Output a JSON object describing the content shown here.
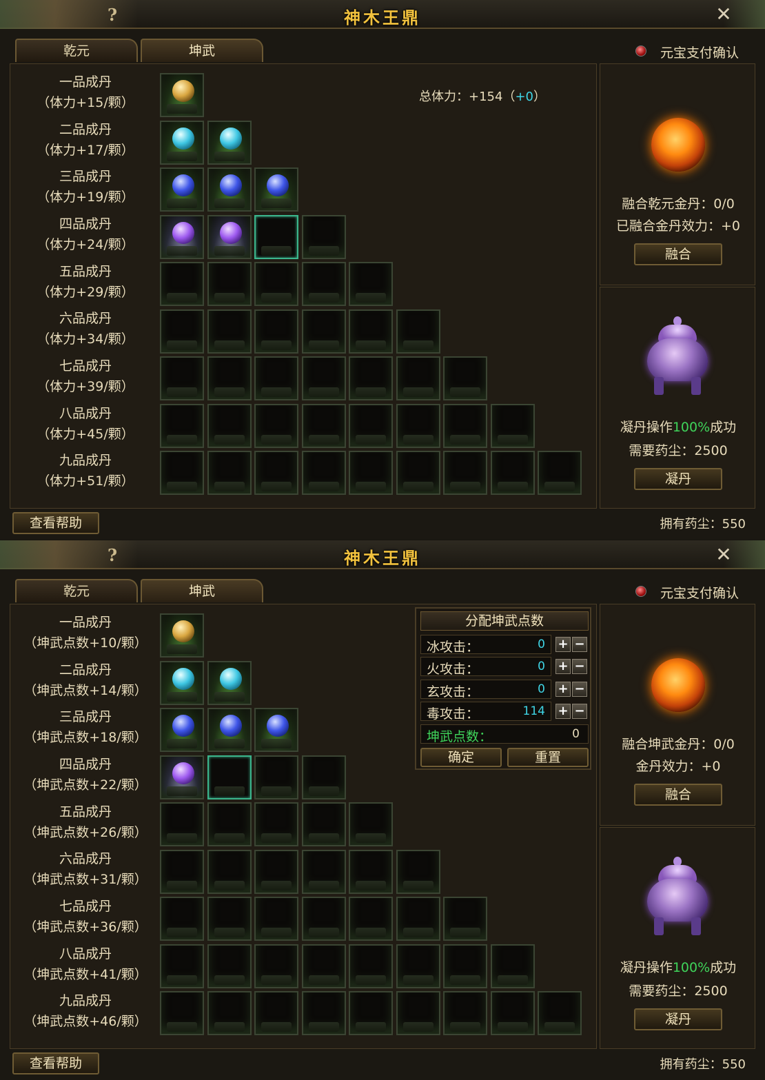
{
  "window_title": "神木王鼎",
  "tabs": [
    "乾元",
    "坤武"
  ],
  "pay_confirm_label": "元宝支付确认",
  "help_button": "查看帮助",
  "owned_dust": "拥有药尘：550",
  "panel1": {
    "rows": [
      {
        "name": "一品成丹",
        "bonus": "（体力+15/颗）"
      },
      {
        "name": "二品成丹",
        "bonus": "（体力+17/颗）"
      },
      {
        "name": "三品成丹",
        "bonus": "（体力+19/颗）"
      },
      {
        "name": "四品成丹",
        "bonus": "（体力+24/颗）"
      },
      {
        "name": "五品成丹",
        "bonus": "（体力+29/颗）"
      },
      {
        "name": "六品成丹",
        "bonus": "（体力+34/颗）"
      },
      {
        "name": "七品成丹",
        "bonus": "（体力+39/颗）"
      },
      {
        "name": "八品成丹",
        "bonus": "（体力+45/颗）"
      },
      {
        "name": "九品成丹",
        "bonus": "（体力+51/颗）"
      }
    ],
    "total_label": "总体力：+154",
    "total_extra": "+0",
    "fuse_label": "融合乾元金丹：0/0",
    "fuse_effect": "已融合金丹效力：+0",
    "fuse_button": "融合",
    "condense_success_prefix": "凝丹操作",
    "condense_success_rate": "100%",
    "condense_success_suffix": "成功",
    "condense_cost": "需要药尘：2500",
    "condense_button": "凝丹"
  },
  "panel2": {
    "rows": [
      {
        "name": "一品成丹",
        "bonus": "（坤武点数+10/颗）"
      },
      {
        "name": "二品成丹",
        "bonus": "（坤武点数+14/颗）"
      },
      {
        "name": "三品成丹",
        "bonus": "（坤武点数+18/颗）"
      },
      {
        "name": "四品成丹",
        "bonus": "（坤武点数+22/颗）"
      },
      {
        "name": "五品成丹",
        "bonus": "（坤武点数+26/颗）"
      },
      {
        "name": "六品成丹",
        "bonus": "（坤武点数+31/颗）"
      },
      {
        "name": "七品成丹",
        "bonus": "（坤武点数+36/颗）"
      },
      {
        "name": "八品成丹",
        "bonus": "（坤武点数+41/颗）"
      },
      {
        "name": "九品成丹",
        "bonus": "（坤武点数+46/颗）"
      }
    ],
    "distribute": {
      "title": "分配坤武点数",
      "stats": [
        {
          "label": "冰攻击：",
          "value": "0"
        },
        {
          "label": "火攻击：",
          "value": "0"
        },
        {
          "label": "玄攻击：",
          "value": "0"
        },
        {
          "label": "毒攻击：",
          "value": "114"
        }
      ],
      "points_label": "坤武点数：",
      "points_value": "0",
      "confirm_button": "确定",
      "reset_button": "重置"
    },
    "fuse_label": "融合坤武金丹：0/0",
    "fuse_effect": "金丹效力：+0",
    "fuse_button": "融合",
    "condense_success_prefix": "凝丹操作",
    "condense_success_rate": "100%",
    "condense_success_suffix": "成功",
    "condense_cost": "需要药尘：2500",
    "condense_button": "凝丹"
  },
  "colors": {
    "title": "#f2c23e",
    "accent_cyan": "#3fd5e6",
    "accent_green": "#3fd45a"
  },
  "icons": {
    "help": "question-mark-icon",
    "close": "close-x-icon",
    "pay": "red-radio-icon"
  }
}
